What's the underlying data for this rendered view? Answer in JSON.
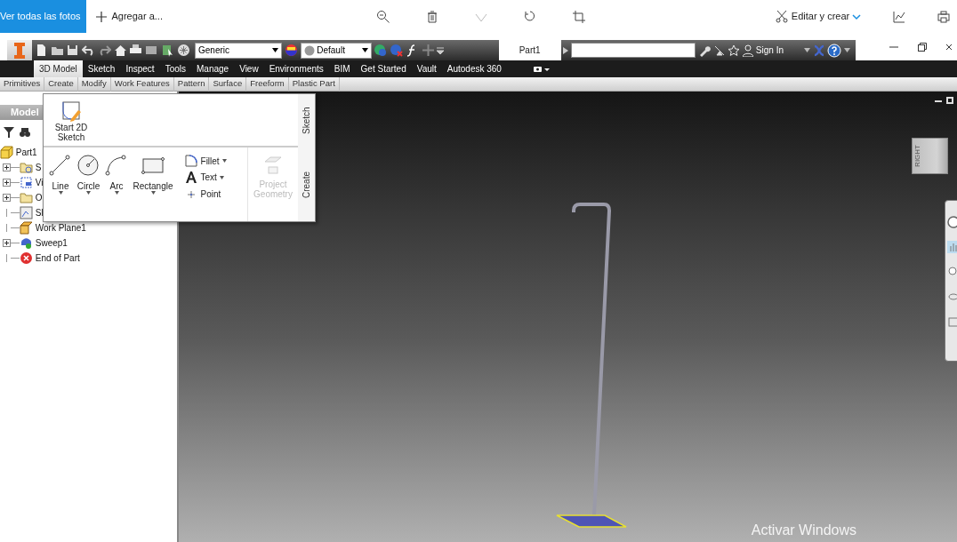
{
  "photo_viewer": {
    "back_button": "Ver todas las fotos",
    "add_button": "Agregar a...",
    "edit_button": "Editar y crear"
  },
  "title_bar": {
    "material": "Generic",
    "appearance": "Default",
    "document_tab": "Part1",
    "sign_in": "Sign In"
  },
  "ribbon_tabs": [
    {
      "label": "3D Model",
      "selected": true
    },
    {
      "label": "Sketch",
      "selected": false
    },
    {
      "label": "Inspect",
      "selected": false
    },
    {
      "label": "Tools",
      "selected": false
    },
    {
      "label": "Manage",
      "selected": false
    },
    {
      "label": "View",
      "selected": false
    },
    {
      "label": "Environments",
      "selected": false
    },
    {
      "label": "BIM",
      "selected": false
    },
    {
      "label": "Get Started",
      "selected": false
    },
    {
      "label": "Vault",
      "selected": false
    },
    {
      "label": "Autodesk 360",
      "selected": false
    }
  ],
  "panel_tabs": [
    "Primitives",
    "Create",
    "Modify",
    "Work Features",
    "Pattern",
    "Surface",
    "Freeform",
    "Plastic Part"
  ],
  "popup": {
    "sketch_title": "Sketch",
    "start_sketch": "Start 2D Sketch",
    "create_title": "Create",
    "tools": [
      {
        "label": "Line",
        "kind": "line"
      },
      {
        "label": "Circle",
        "kind": "circle"
      },
      {
        "label": "Arc",
        "kind": "arc"
      },
      {
        "label": "Rectangle",
        "kind": "rectangle"
      }
    ],
    "small_tools": [
      {
        "label": "Fillet",
        "kind": "fillet",
        "dropdown": true
      },
      {
        "label": "Text",
        "kind": "text",
        "dropdown": true
      },
      {
        "label": "Point",
        "kind": "point",
        "dropdown": false
      }
    ],
    "project_geometry": {
      "label": "Project Geometry",
      "disabled": true
    }
  },
  "browser": {
    "title": "Model",
    "root": {
      "label": "Part1",
      "kind": "part",
      "children": [
        {
          "label": "S",
          "kind": "folder-sketch",
          "has_children": true
        },
        {
          "label": "Vi",
          "kind": "view",
          "has_children": true
        },
        {
          "label": "O",
          "kind": "folder",
          "has_children": true
        },
        {
          "label": "Sl",
          "kind": "sketch",
          "has_children": false
        },
        {
          "label": "Work Plane1",
          "kind": "plane",
          "has_children": false
        },
        {
          "label": "Sweep1",
          "kind": "sweep",
          "has_children": true
        },
        {
          "label": "End of Part",
          "kind": "end",
          "has_children": false
        }
      ]
    }
  },
  "viewcube": "RIGHT",
  "watermark": "Activar Windows"
}
